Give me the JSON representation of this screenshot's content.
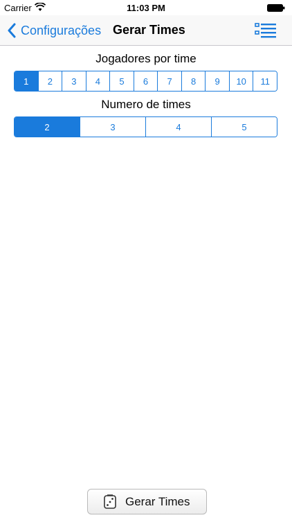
{
  "status_bar": {
    "carrier": "Carrier",
    "time": "11:03 PM"
  },
  "nav_bar": {
    "back_label": "Configurações",
    "title": "Gerar Times",
    "right_icon": "list-icon"
  },
  "players_per_team": {
    "label": "Jogadores por time",
    "options": [
      "1",
      "2",
      "3",
      "4",
      "5",
      "6",
      "7",
      "8",
      "9",
      "10",
      "11"
    ],
    "selected": "1"
  },
  "number_of_teams": {
    "label": "Numero de times",
    "options": [
      "2",
      "3",
      "4",
      "5"
    ],
    "selected": "2"
  },
  "generate_button": {
    "label": "Gerar Times",
    "icon": "dice-icon"
  },
  "colors": {
    "accent": "#1a7bdc"
  }
}
